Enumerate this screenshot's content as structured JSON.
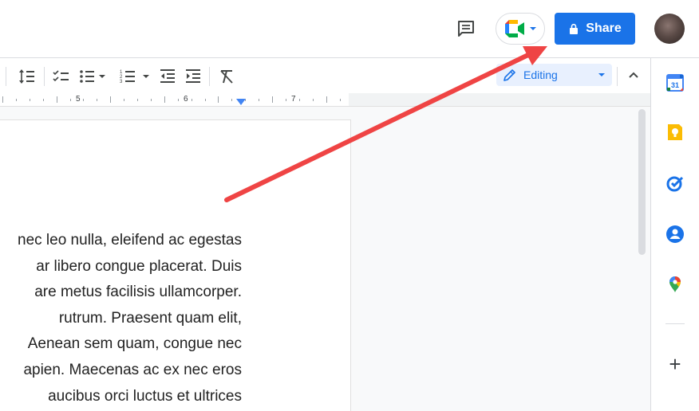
{
  "header": {
    "share_label": "Share",
    "comments_icon": "comment-history-icon",
    "meet_icon": "google-meet-icon",
    "avatar_icon": "account-avatar"
  },
  "toolbar": {
    "icons": [
      "line-spacing-icon",
      "checklist-icon",
      "bulleted-list-icon",
      "numbered-list-icon",
      "decrease-indent-icon",
      "increase-indent-icon",
      "clear-formatting-icon"
    ],
    "mode_label": "Editing"
  },
  "ruler": {
    "numbers": [
      "5",
      "6",
      "7"
    ]
  },
  "document": {
    "lines": [
      "nec leo nulla, eleifend ac egestas",
      "ar libero congue placerat. Duis",
      "are metus facilisis ullamcorper.",
      "rutrum. Praesent quam elit,",
      "Aenean sem quam, congue nec",
      "apien. Maecenas ac ex nec eros",
      "aucibus orci luctus et ultrices"
    ]
  },
  "side_panel": {
    "apps": [
      "google-calendar-icon",
      "google-keep-icon",
      "google-tasks-icon",
      "google-contacts-icon",
      "google-maps-icon"
    ],
    "add_label": "+",
    "calendar_day": "31"
  },
  "annotation": {
    "arrow_color": "#ef4444"
  },
  "colors": {
    "accent": "#1a73e8",
    "editing_bg": "#e8f0fe"
  }
}
